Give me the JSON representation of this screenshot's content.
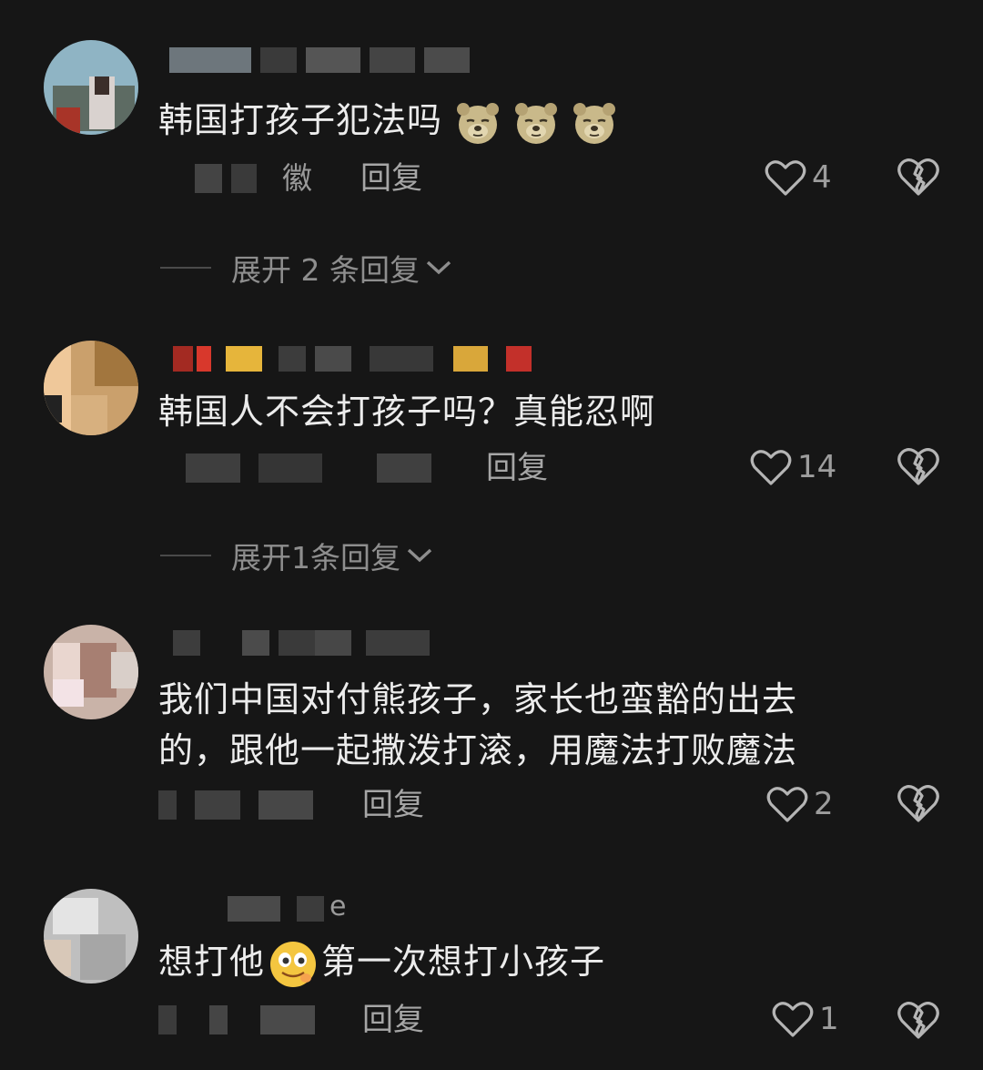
{
  "comments": [
    {
      "text": "韩国打孩子犯法吗",
      "location_partial": "徽",
      "reply_label": "回复",
      "likes": "4",
      "expand": {
        "label": "展开 2 条回复"
      },
      "emoji_names": [
        "bear-emoji",
        "bear-emoji",
        "bear-emoji"
      ]
    },
    {
      "text": "韩国人不会打孩子吗？真能忍啊",
      "reply_label": "回复",
      "likes": "14",
      "expand": {
        "label": "展开1条回复"
      }
    },
    {
      "text_line1": "我们中国对付熊孩子，家长也蛮豁的出去",
      "text_line2": "的，跟他一起撒泼打滚，用魔法打败魔法",
      "reply_label": "回复",
      "likes": "2"
    },
    {
      "name_partial": "e",
      "text_before": "想打他",
      "text_after": "第一次想打小孩子",
      "emoji_name": "drooling-smile-emoji",
      "reply_label": "回复",
      "likes": "1"
    }
  ],
  "icons": {
    "like": "heart-outline-icon",
    "dislike": "broken-heart-icon",
    "expand": "chevron-down-icon"
  },
  "colors": {
    "background": "#161616",
    "text": "#ececec",
    "muted": "#9a9a9a"
  }
}
